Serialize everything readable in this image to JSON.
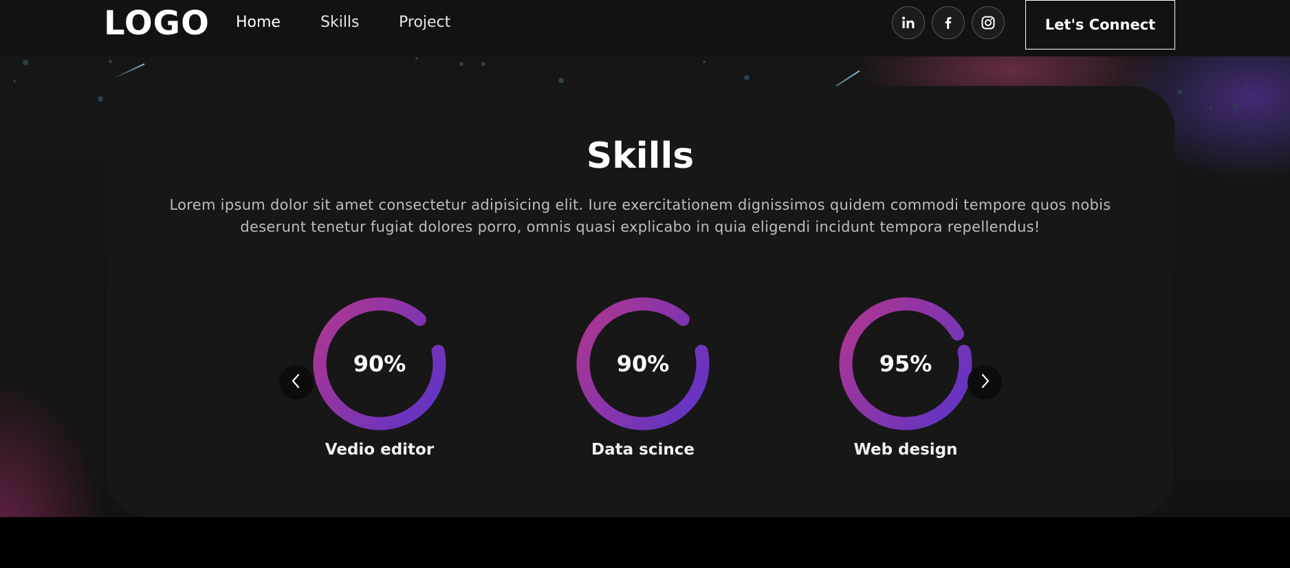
{
  "nav": {
    "logo": "LOGO",
    "links": [
      "Home",
      "Skills",
      "Project"
    ],
    "connect_label": "Let's Connect",
    "social_icons": [
      "linkedin-icon",
      "facebook-icon",
      "instagram-icon"
    ]
  },
  "skills": {
    "title": "Skills",
    "description": "Lorem ipsum dolor sit amet consectetur adipisicing elit. Iure exercitationem dignissimos quidem commodi tempore quos nobis deserunt tenetur fugiat dolores porro, omnis quasi explicabo in quia eligendi incidunt tempora repellendus!",
    "items": [
      {
        "value": "90%",
        "label": "Vedio editor",
        "percent": 90
      },
      {
        "value": "90%",
        "label": "Data scince",
        "percent": 90
      },
      {
        "value": "95%",
        "label": "Web design",
        "percent": 95
      }
    ]
  },
  "colors": {
    "ring_start": "#b1368f",
    "ring_end": "#5b34c9",
    "navbar_bg": "#121212",
    "card_bg": "#171717"
  }
}
